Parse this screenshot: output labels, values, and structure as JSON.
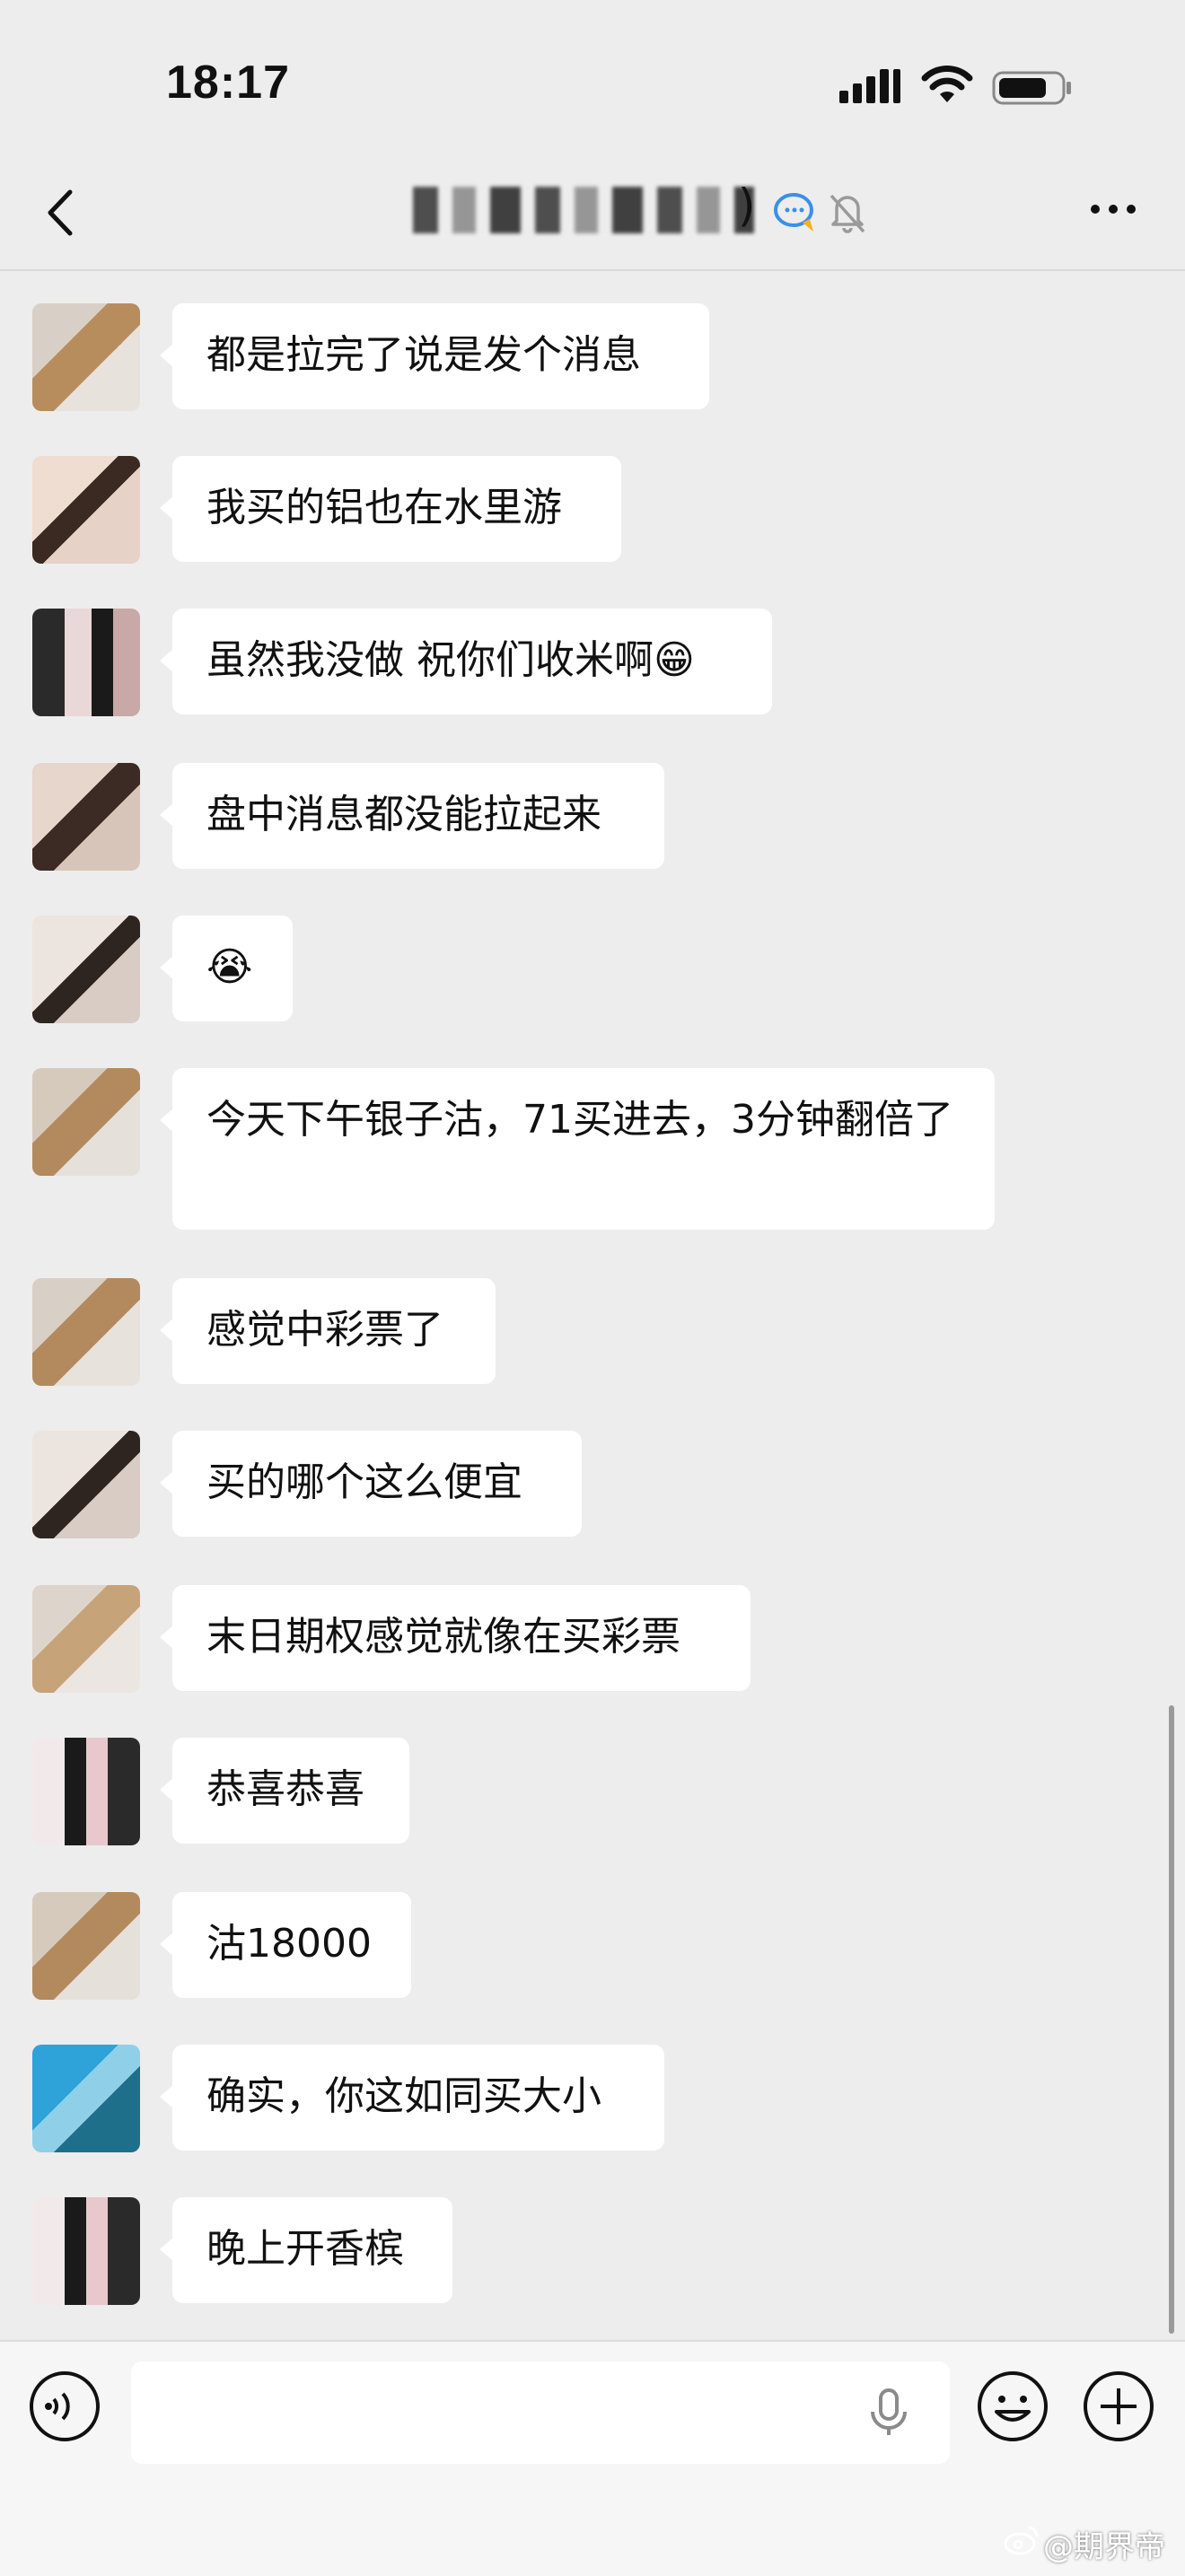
{
  "status_bar": {
    "time": "18:17"
  },
  "header": {
    "title_suffix": ")"
  },
  "messages": [
    {
      "text": "都是拉完了说是发个消息"
    },
    {
      "text": "我买的铝也在水里游"
    },
    {
      "text": "虽然我没做 祝你们收米啊😁"
    },
    {
      "text": "盘中消息都没能拉起来"
    },
    {
      "text": "😭"
    },
    {
      "text": "今天下午银子沽，71买进去，3分钟翻倍了"
    },
    {
      "text": "感觉中彩票了"
    },
    {
      "text": "买的哪个这么便宜"
    },
    {
      "text": "末日期权感觉就像在买彩票"
    },
    {
      "text": "恭喜恭喜"
    },
    {
      "text": "沽18000"
    },
    {
      "text": "确实，你这如同买大小"
    },
    {
      "text": "晚上开香槟"
    }
  ],
  "input_bar": {
    "placeholder": ""
  },
  "watermark": {
    "text": "@期界帝"
  },
  "colors": {
    "background": "#ededed",
    "bubble": "#ffffff",
    "accent": "#07c160"
  }
}
